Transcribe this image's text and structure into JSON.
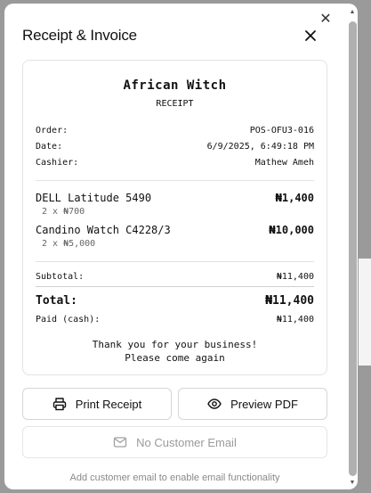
{
  "dialog": {
    "title": "Receipt & Invoice"
  },
  "receipt": {
    "store_name": "African Witch",
    "label": "RECEIPT",
    "meta": [
      {
        "label": "Order:",
        "value": "POS-OFU3-016"
      },
      {
        "label": "Date:",
        "value": "6/9/2025, 6:49:18 PM"
      },
      {
        "label": "Cashier:",
        "value": "Mathew Ameh"
      }
    ],
    "items": [
      {
        "name": "DELL Latitude 5490",
        "qty": "2 x ₦700",
        "price": "₦1,400"
      },
      {
        "name": "Candino Watch C4228/3",
        "qty": "2 x ₦5,000",
        "price": "₦10,000"
      }
    ],
    "subtotal_label": "Subtotal:",
    "subtotal_value": "₦11,400",
    "total_label": "Total:",
    "total_value": "₦11,400",
    "paid_label": "Paid (cash):",
    "paid_value": "₦11,400",
    "thanks_line1": "Thank you for your business!",
    "thanks_line2": "Please come again"
  },
  "actions": {
    "print_label": "Print Receipt",
    "preview_label": "Preview PDF",
    "email_label": "No Customer Email",
    "hint": "Add customer email to enable email functionality"
  },
  "icons": {
    "close": "close-icon",
    "print": "printer-icon",
    "preview": "eye-icon",
    "email": "mail-icon"
  }
}
